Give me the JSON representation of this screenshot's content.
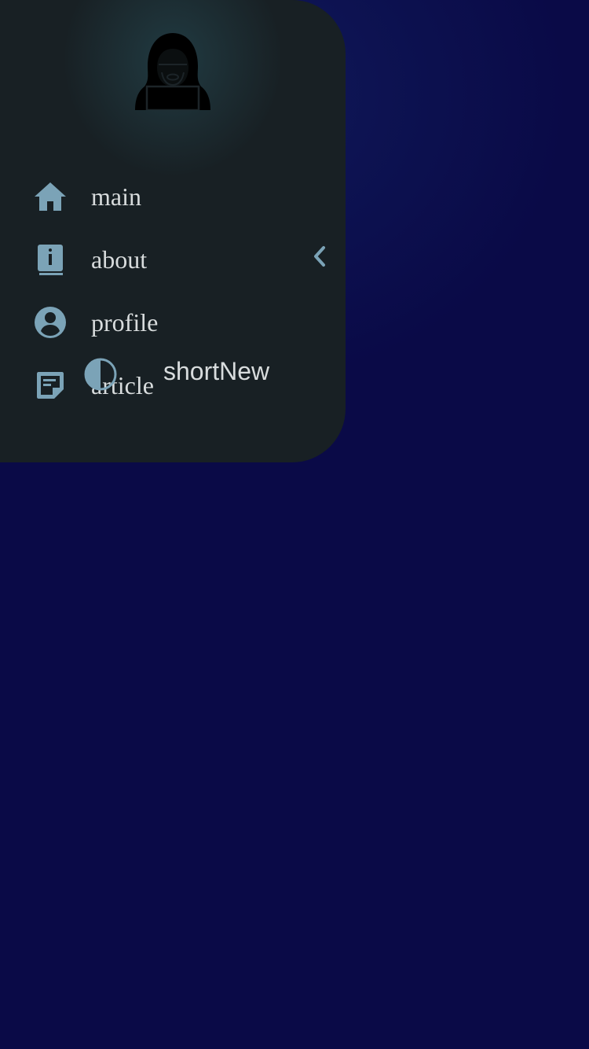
{
  "colors": {
    "page_background": "#0a0a47",
    "drawer_background": "#182024",
    "icon_accent": "#7ba3b7",
    "text": "#d8dcdd"
  },
  "drawer": {
    "avatar_icon": "hacker-icon",
    "nav_items": [
      {
        "label": "main",
        "icon": "home-icon"
      },
      {
        "label": "about",
        "icon": "info-book-icon"
      },
      {
        "label": "profile",
        "icon": "account-circle-icon"
      },
      {
        "label": "article",
        "icon": "note-icon"
      }
    ],
    "collapse_icon": "chevron-left-icon",
    "theme_toggle": {
      "icon": "contrast-icon",
      "label": "shortNew"
    }
  }
}
